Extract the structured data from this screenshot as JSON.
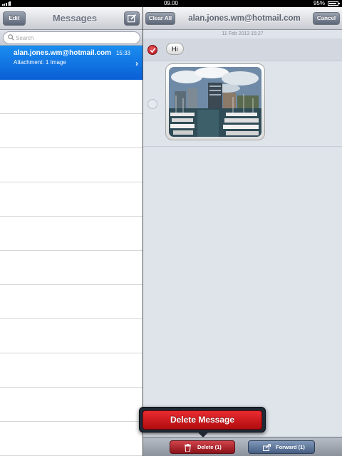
{
  "status_bar": {
    "time": "09.00",
    "battery": "95%"
  },
  "left_pane": {
    "edit_label": "Edit",
    "title": "Messages",
    "search": {
      "placeholder": "Search",
      "value": ""
    },
    "conversations": [
      {
        "name": "alan.jones.wm@hotmail.com",
        "time": "15:33",
        "preview": "Attachment: 1 Image",
        "selected": true
      }
    ]
  },
  "right_pane": {
    "clear_all_label": "Clear All",
    "title": "alan.jones.wm@hotmail.com",
    "cancel_label": "Cancel",
    "date": "11 Feb 2013 15:27",
    "messages": [
      {
        "type": "text",
        "text": "Hi",
        "checked": true
      },
      {
        "type": "image",
        "checked": false,
        "image_icon": "photo-harbour"
      }
    ]
  },
  "toolbar": {
    "delete_label": "Delete (1)",
    "forward_label": "Forward (1)"
  },
  "popover": {
    "delete_message_label": "Delete Message"
  },
  "colors": {
    "accent": "#0a6be0",
    "delete": "#c81b21",
    "forward": "#5a7094"
  }
}
